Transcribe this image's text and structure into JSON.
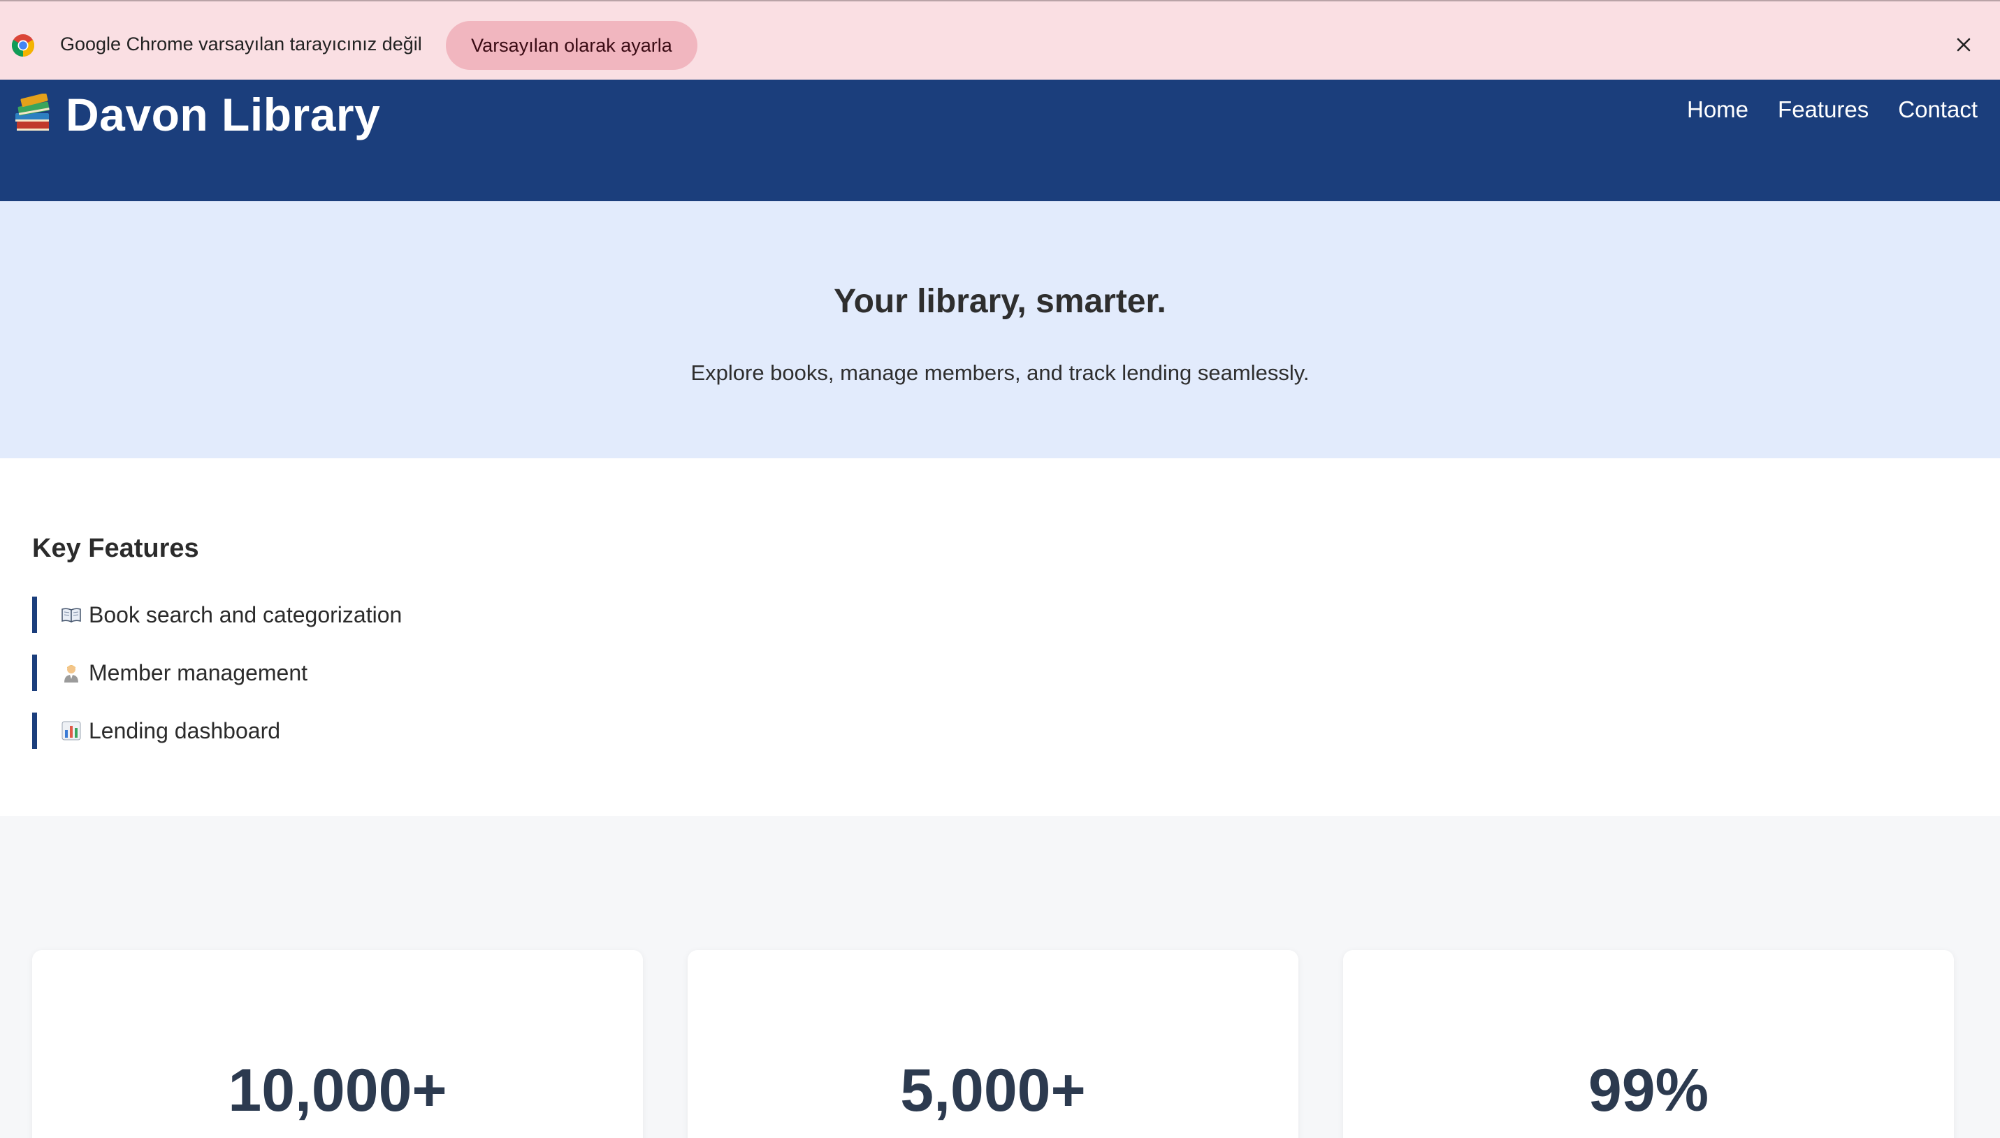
{
  "infobar": {
    "message": "Google Chrome varsayılan tarayıcınız değil",
    "default_button": "Varsayılan olarak ayarla",
    "background_color": "#fadfe3"
  },
  "header": {
    "title": "Davon Library",
    "brand_icon": "books-icon",
    "nav": {
      "home": "Home",
      "features": "Features",
      "contact": "Contact"
    },
    "background_color": "#1b3e7c"
  },
  "hero": {
    "title": "Your library, smarter.",
    "subtitle": "Explore books, manage members, and track lending seamlessly.",
    "background_color": "#e2ebfc"
  },
  "features": {
    "heading": "Key Features",
    "items": [
      {
        "icon": "open-book-icon",
        "label": "Book search and categorization"
      },
      {
        "icon": "member-icon",
        "label": "Member management"
      },
      {
        "icon": "bar-chart-icon",
        "label": "Lending dashboard"
      }
    ]
  },
  "stats": [
    {
      "value": "10,000+"
    },
    {
      "value": "5,000+"
    },
    {
      "value": "99%"
    }
  ]
}
